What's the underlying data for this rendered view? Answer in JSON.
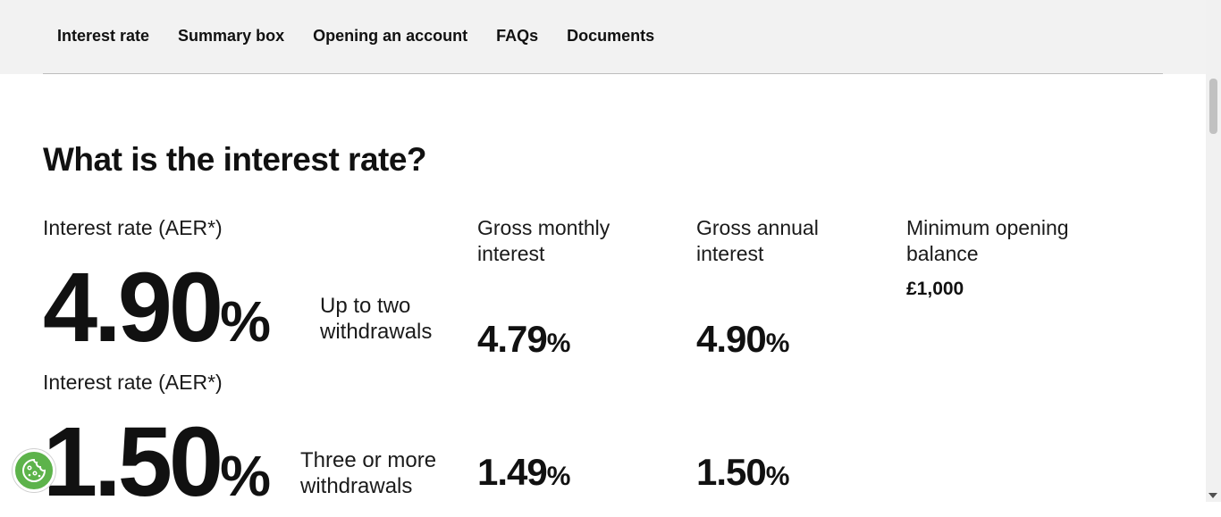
{
  "nav": {
    "items": [
      {
        "label": "Interest rate"
      },
      {
        "label": "Summary box"
      },
      {
        "label": "Opening an account"
      },
      {
        "label": "FAQs"
      },
      {
        "label": "Documents"
      }
    ]
  },
  "section": {
    "heading": "What is the interest rate?"
  },
  "rates": {
    "columns": {
      "aer_label": "Interest rate (AER*)",
      "monthly_label": "Gross monthly interest",
      "annual_label": "Gross annual interest",
      "min_balance_label": "Minimum opening balance",
      "min_balance_value": "£1,000"
    },
    "rows": [
      {
        "aer_label": "Interest rate (AER*)",
        "aer": "4.90",
        "condition": "Up to two withdrawals",
        "monthly": "4.79",
        "annual": "4.90"
      },
      {
        "aer_label": "Interest rate (AER*)",
        "aer": "1.50",
        "condition": "Three or more withdrawals",
        "monthly": "1.49",
        "annual": "1.50"
      }
    ],
    "percent_sign": "%"
  },
  "cookie": {
    "icon": "cookie-icon",
    "color": "#5db34b"
  }
}
